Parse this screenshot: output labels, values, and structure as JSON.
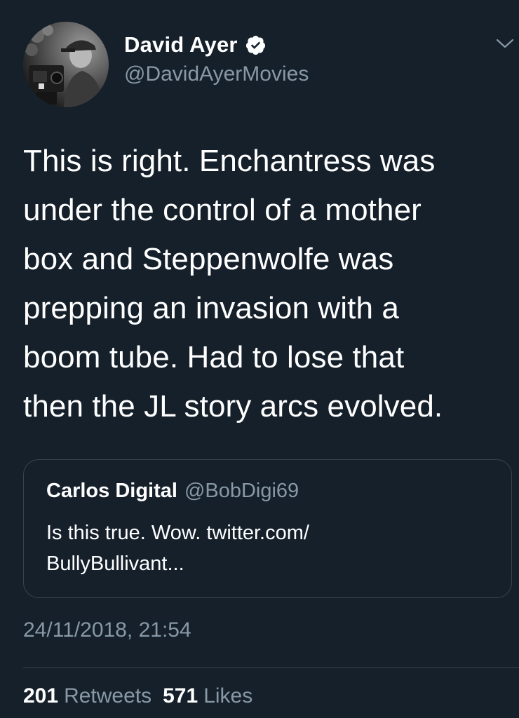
{
  "tweet": {
    "author": {
      "display_name": "David Ayer",
      "handle": "@DavidAyerMovies",
      "verified": true,
      "avatar_icon": "profile-photo-avatar",
      "verified_icon": "verified-badge-icon"
    },
    "menu_icon": "chevron-down-icon",
    "text_lines": [
      "This is right. Enchantress was",
      "under the control of a mother",
      "box and Steppenwolfe was",
      "prepping an invasion with a",
      "boom tube. Had to lose that",
      "then the JL story arcs evolved."
    ],
    "quoted_tweet": {
      "display_name": "Carlos Digital",
      "handle": "@BobDigi69",
      "text_lines": [
        "Is this true. Wow. twitter.com/",
        "BullyBullivant..."
      ]
    },
    "timestamp": "24/11/2018, 21:54",
    "stats": {
      "retweets_count": "201",
      "retweets_label": "Retweets",
      "likes_count": "571",
      "likes_label": "Likes"
    }
  },
  "colors": {
    "background": "#15202b",
    "primary_text": "#ffffff",
    "secondary_text": "#8899a6",
    "border": "#38444d",
    "verified_badge": "#ffffff"
  }
}
